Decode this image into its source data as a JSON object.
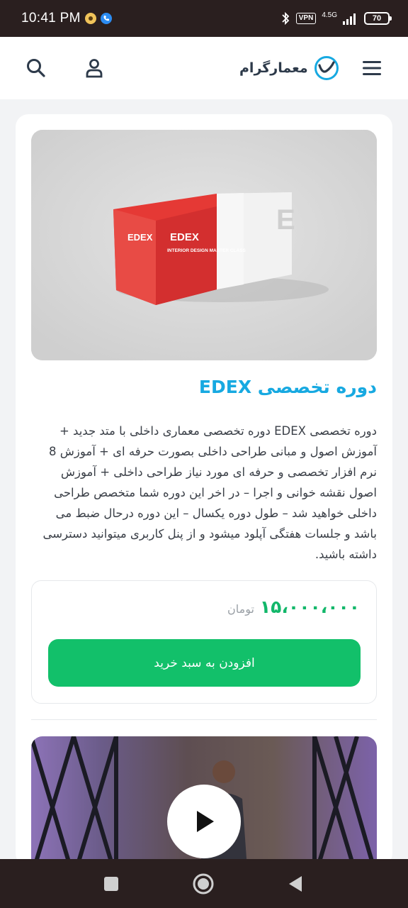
{
  "status_bar": {
    "time": "10:41 PM",
    "vpn": "VPN",
    "network": "4.5G",
    "battery": "70"
  },
  "header": {
    "brand_name": "معمارگرام",
    "icons": [
      "search-icon",
      "user-icon",
      "brand-logo",
      "menu-icon"
    ]
  },
  "product": {
    "title": "دوره تخصصی EDEX",
    "description": "دوره تخصصی EDEX دوره تخصصی معماری داخلی با متد جدید + آموزش اصول و مبانی طراحی داخلی بصورت حرفه ای + آموزش 8 نرم افزار تخصصی و حرفه ای مورد نیاز طراحی داخلی + آموزش اصول نقشه خوانی و اجرا – در اخر این دوره شما متخصص طراحی داخلی خواهید شد – طول دوره یکسال – این دوره درحال ضبط می باشد و جلسات هفتگی آپلود میشود و از پنل کاربری میتوانید دسترسی داشته باشید.",
    "box_brand": "EDEX",
    "box_subtitle": "INTERIOR DESIGN MASTER CLASS",
    "price": "۱۵،۰۰۰،۰۰۰",
    "currency": "تومان",
    "add_to_cart": "افزودن به سبد خرید"
  },
  "colors": {
    "accent_blue": "#17a9e1",
    "accent_green": "#12c06a",
    "box_red": "#e53935"
  }
}
